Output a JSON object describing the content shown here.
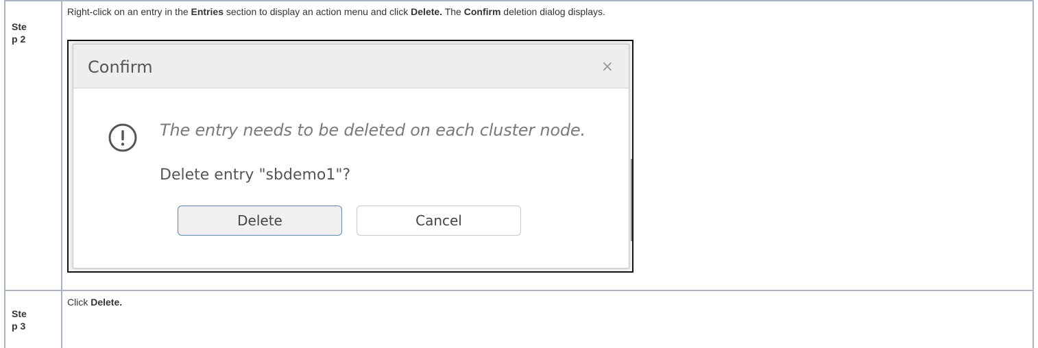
{
  "steps": [
    {
      "label_line1": "Ste",
      "label_line2": "p 2",
      "text_parts": [
        {
          "t": "Right-click on an entry in the ",
          "b": false
        },
        {
          "t": "Entries",
          "b": true
        },
        {
          "t": " section to display an action menu and click ",
          "b": false
        },
        {
          "t": "Delete.",
          "b": true
        },
        {
          "t": " The ",
          "b": false
        },
        {
          "t": "Confirm",
          "b": true
        },
        {
          "t": " deletion dialog displays.",
          "b": false
        }
      ]
    },
    {
      "label_line1": "Ste",
      "label_line2": "p 3",
      "text_parts": [
        {
          "t": "Click ",
          "b": false
        },
        {
          "t": "Delete.",
          "b": true
        }
      ]
    }
  ],
  "dialog": {
    "title": "Confirm",
    "close_symbol": "×",
    "message": "The entry needs to be deleted on each cluster node.",
    "question": "Delete entry \"sbdemo1\"?",
    "delete_label": "Delete",
    "cancel_label": "Cancel",
    "icon": "exclamation-circle-icon"
  },
  "colors": {
    "table_border": "#a9b4c5",
    "button_focus_border": "#5b8ab3"
  }
}
